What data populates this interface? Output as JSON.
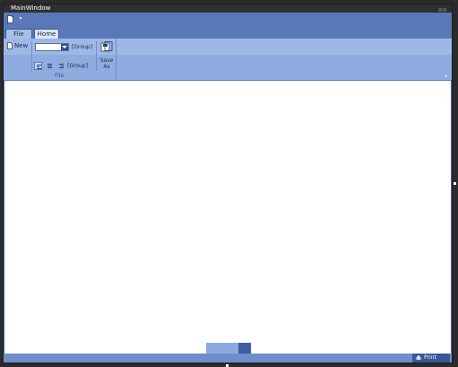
{
  "window": {
    "title": "MainWindow"
  },
  "quick_access": {
    "new_icon": "document-icon",
    "dropdown_icon": "chevron-down-icon",
    "dropdown_glyph": "▾"
  },
  "tabs": [
    {
      "label": "File"
    },
    {
      "label": "Home",
      "selected": true
    }
  ],
  "ribbon": {
    "group_file": {
      "label": "File",
      "new_label": "New",
      "new_icon": "document-icon",
      "combo_value": "",
      "group_label_1": "[Group]",
      "group_label_2": "[Group]",
      "align_icons": [
        "align-left-icon",
        "align-center-icon",
        "align-right-icon"
      ],
      "save_as_label": "Save As",
      "save_as_icon": "save-as-icon"
    },
    "launcher_glyph": "◂"
  },
  "statusbar": {
    "print_label": "Print",
    "print_icon": "printer-icon"
  },
  "colors": {
    "accent": "#4a68a8",
    "ribbon": "#8eacdf",
    "tab_selected": "#dbe6f8"
  }
}
